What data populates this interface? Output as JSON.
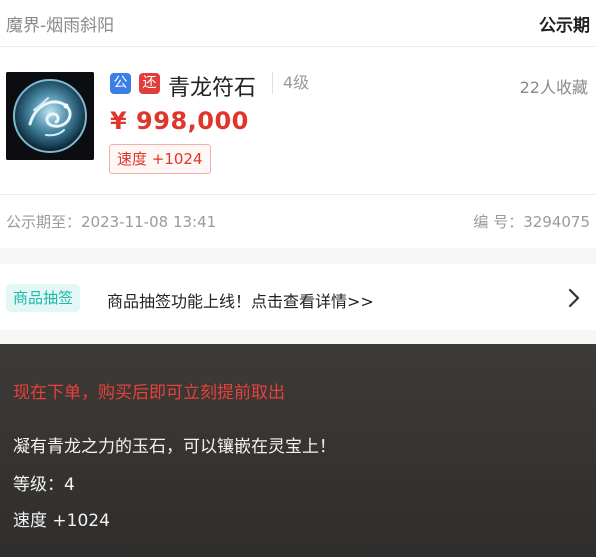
{
  "header": {
    "server_name": "魔界-烟雨斜阳",
    "status_label": "公示期"
  },
  "item": {
    "image_icon": "dragon-stone-icon",
    "tags": [
      "公",
      "还"
    ],
    "tag_colors": [
      "#3a7ee6",
      "#e23d3d"
    ],
    "name": "青龙符石",
    "level": "4级",
    "favorites": "22人收藏",
    "price": "¥ 998,000",
    "attribute": "速度 +1024"
  },
  "meta": {
    "period_until": "公示期至：2023-11-08 13:41",
    "serial": "编 号：3294075"
  },
  "promo": {
    "badge": "商品抽签",
    "text": "商品抽签功能上线！点击查看详情>>",
    "chevron_icon": "chevron-right-icon"
  },
  "description": {
    "warning": "现在下单，购买后即可立刻提前取出",
    "lines": [
      "凝有青龙之力的玉石，可以镶嵌在灵宝上！",
      "等级：4",
      "速度 +1024"
    ]
  },
  "colors": {
    "price": "#e0352b",
    "promo_accent": "#1fb8ad",
    "warning": "#e8403a"
  }
}
